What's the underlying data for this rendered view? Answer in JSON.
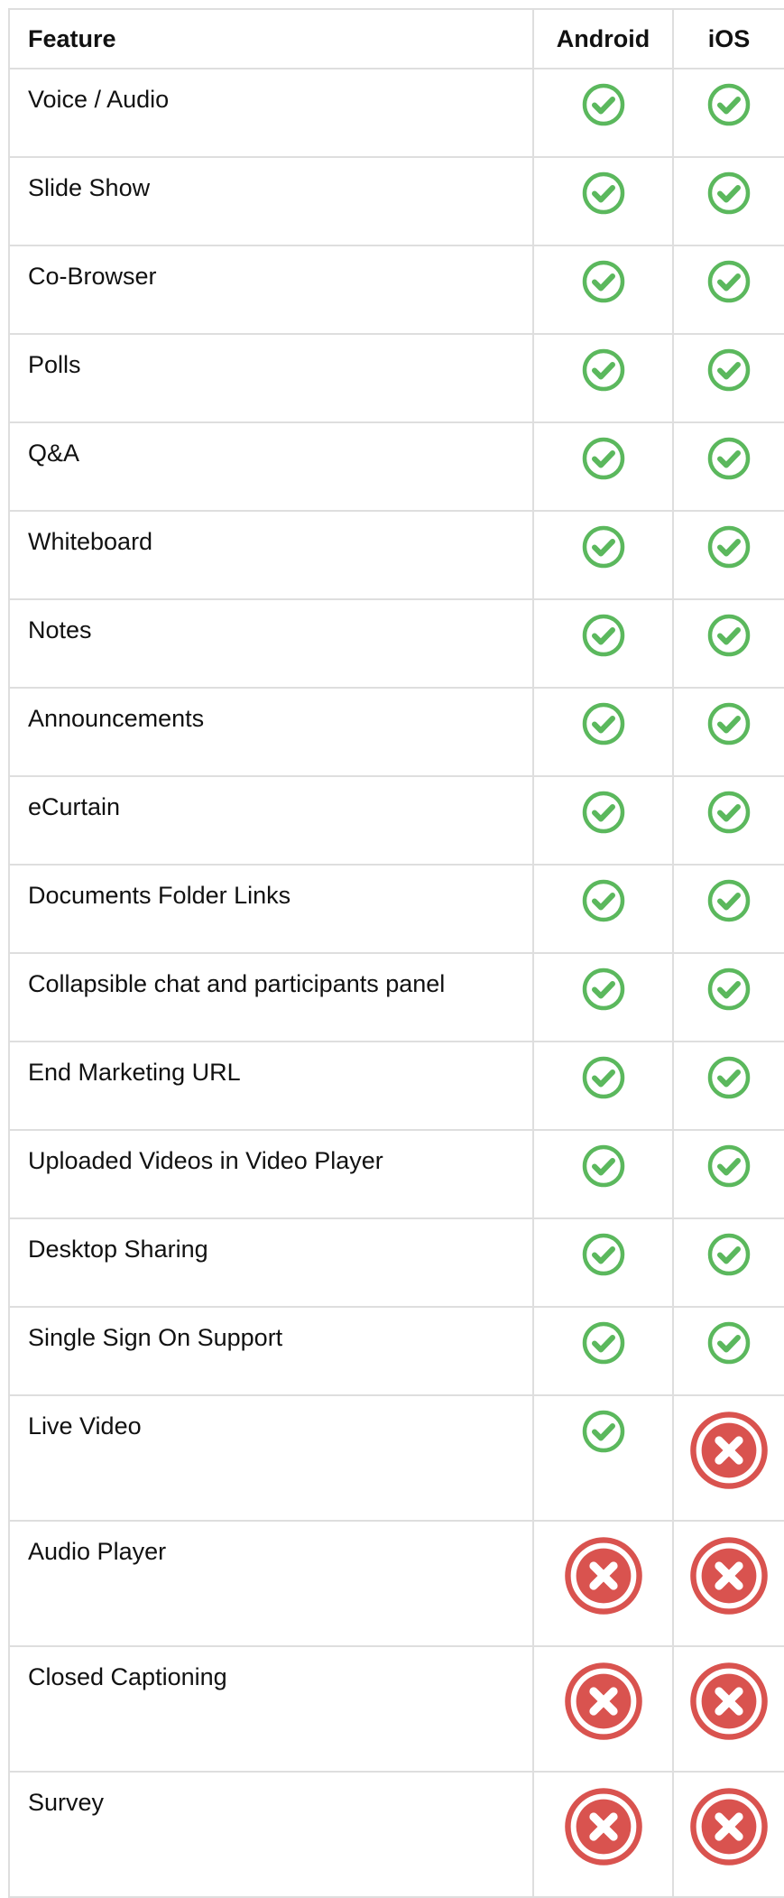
{
  "header": {
    "feature": "Feature",
    "android": "Android",
    "ios": "iOS"
  },
  "colors": {
    "check": "#5bb85d",
    "cross": "#d9534f",
    "border": "#dedede"
  },
  "icons": {
    "supported": "check-circle-icon",
    "unsupported": "x-circle-icon"
  },
  "rows": [
    {
      "feature": "Voice / Audio",
      "android": true,
      "ios": true
    },
    {
      "feature": "Slide Show",
      "android": true,
      "ios": true
    },
    {
      "feature": "Co-Browser",
      "android": true,
      "ios": true
    },
    {
      "feature": "Polls",
      "android": true,
      "ios": true
    },
    {
      "feature": "Q&A",
      "android": true,
      "ios": true
    },
    {
      "feature": "Whiteboard",
      "android": true,
      "ios": true
    },
    {
      "feature": "Notes",
      "android": true,
      "ios": true
    },
    {
      "feature": "Announcements",
      "android": true,
      "ios": true
    },
    {
      "feature": "eCurtain",
      "android": true,
      "ios": true
    },
    {
      "feature": "Documents Folder Links",
      "android": true,
      "ios": true
    },
    {
      "feature": "Collapsible chat and participants panel",
      "android": true,
      "ios": true
    },
    {
      "feature": "End Marketing URL",
      "android": true,
      "ios": true
    },
    {
      "feature": "Uploaded Videos in Video Player",
      "android": true,
      "ios": true
    },
    {
      "feature": "Desktop Sharing",
      "android": true,
      "ios": true
    },
    {
      "feature": "Single Sign On Support",
      "android": true,
      "ios": true
    },
    {
      "feature": "Live Video",
      "android": true,
      "ios": false
    },
    {
      "feature": "Audio Player",
      "android": false,
      "ios": false
    },
    {
      "feature": "Closed Captioning",
      "android": false,
      "ios": false
    },
    {
      "feature": "Survey",
      "android": false,
      "ios": false
    }
  ]
}
